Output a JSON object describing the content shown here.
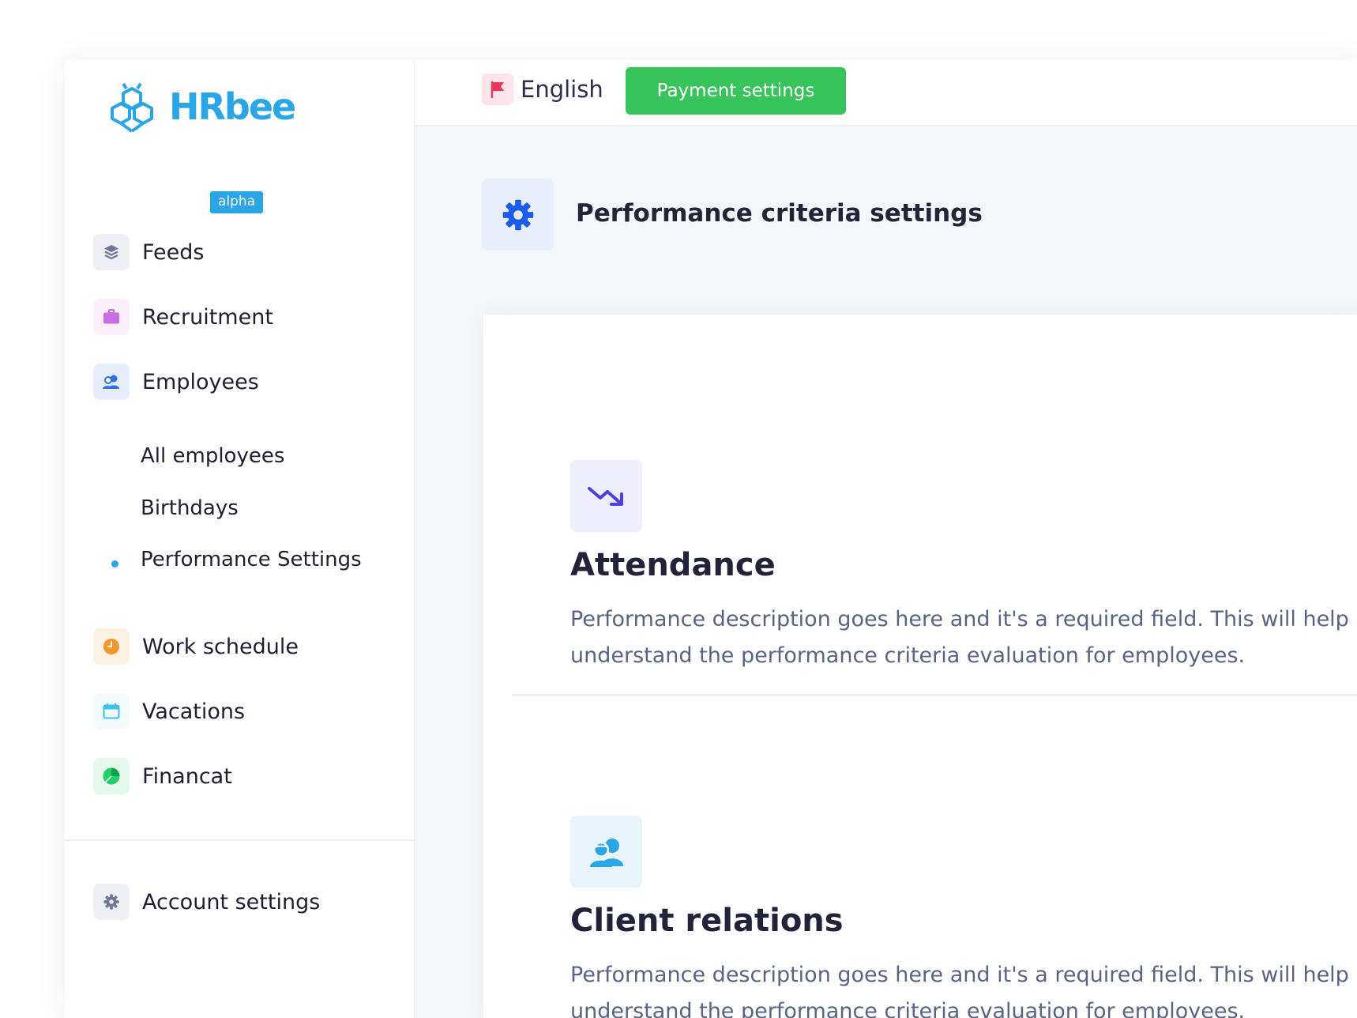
{
  "brand": {
    "name": "HRbee",
    "badge": "alpha"
  },
  "sidebar": {
    "items": [
      {
        "label": "Feeds",
        "icon": "layers-icon"
      },
      {
        "label": "Recruitment",
        "icon": "briefcase-icon"
      },
      {
        "label": "Employees",
        "icon": "users-icon"
      },
      {
        "label": "Work schedule",
        "icon": "clock-icon"
      },
      {
        "label": "Vacations",
        "icon": "calendar-icon"
      },
      {
        "label": "Financat",
        "icon": "pie-chart-icon"
      }
    ],
    "employees_sub": [
      {
        "label": "All employees"
      },
      {
        "label": "Birthdays"
      },
      {
        "label": "Performance Settings",
        "active": true
      }
    ],
    "account_settings": "Account settings"
  },
  "topbar": {
    "language": "English",
    "payment_button": "Payment settings"
  },
  "page": {
    "title": "Performance criteria settings"
  },
  "criteria": [
    {
      "title": "Attendance",
      "description": "Performance description goes here and it's a required field. This will help understand the performance criteria evaluation for employees.",
      "icon": "trending-down-icon"
    },
    {
      "title": "Client relations",
      "description": "Performance description goes here and it's a required field. This will help understand the performance criteria evaluation for employees.",
      "icon": "users-icon"
    }
  ],
  "colors": {
    "accent": "#2aa5e6",
    "green": "#37c45a",
    "gear": "#1a5cf0"
  }
}
